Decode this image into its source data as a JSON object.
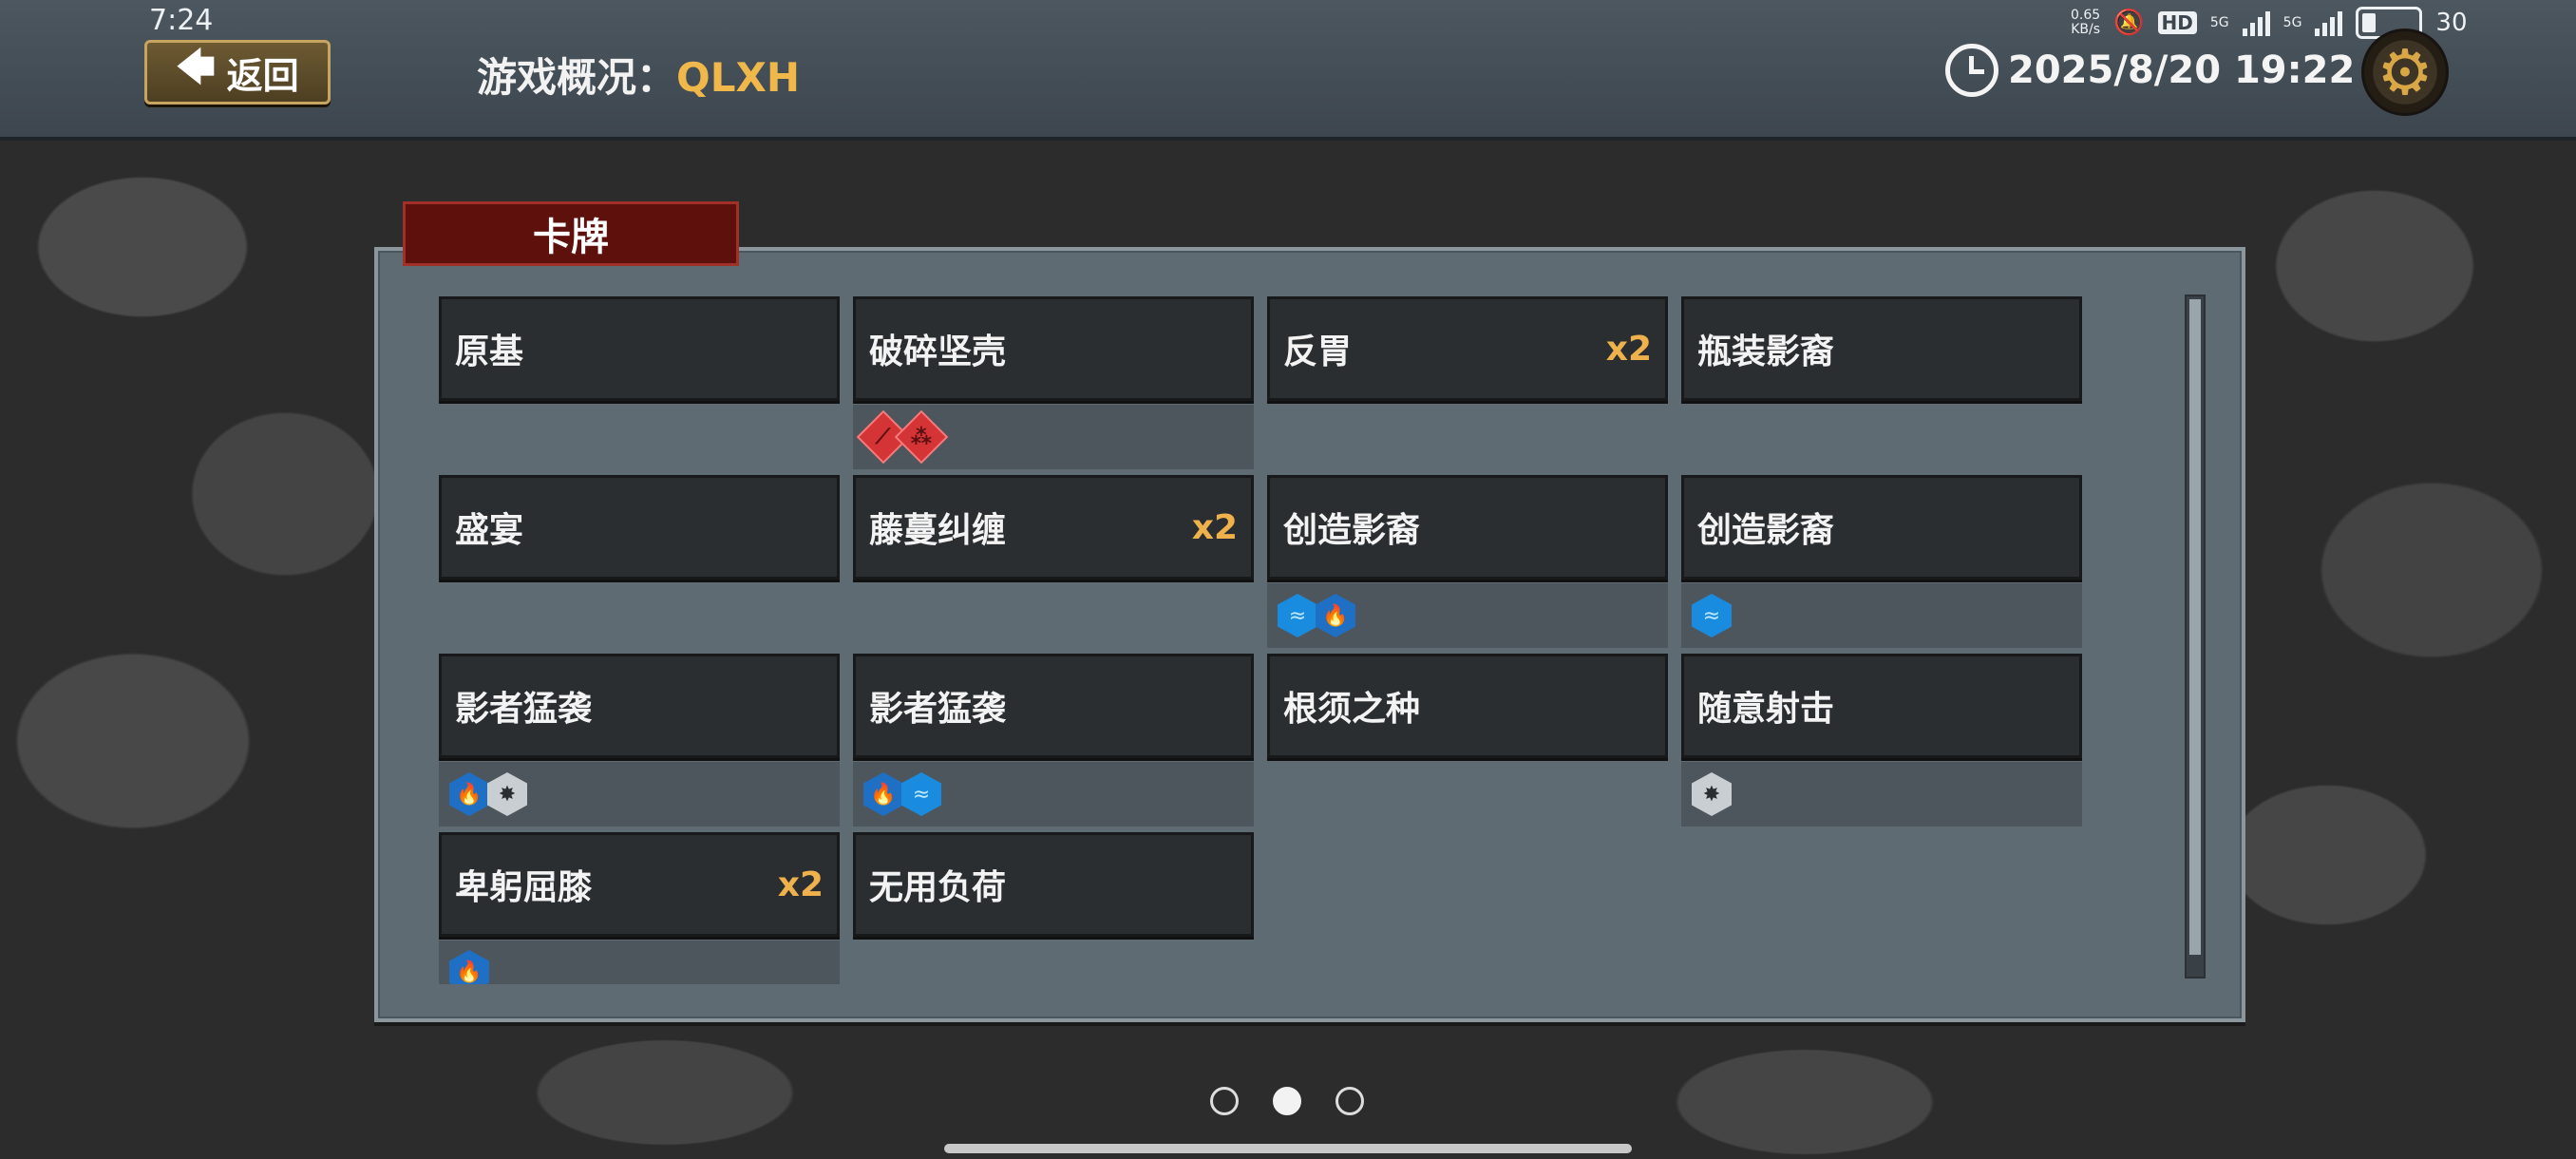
{
  "status_bar": {
    "time": "7:24",
    "net_speed_value": "0.65",
    "net_speed_unit": "KB/s",
    "hd_label": "HD",
    "signal_1_label": "5G",
    "signal_2_label": "5G",
    "battery_level": "30"
  },
  "header": {
    "back_label": "返回",
    "title_prefix": "游戏概况：",
    "game_name": "QLXH",
    "datetime": "2025/8/20 19:22"
  },
  "panel": {
    "tab_label": "卡牌"
  },
  "cards": [
    {
      "name": "原基",
      "count": "",
      "tags": []
    },
    {
      "name": "破碎坚壳",
      "count": "",
      "tags": [
        "sword",
        "bleed"
      ]
    },
    {
      "name": "反胃",
      "count": "x2",
      "tags": []
    },
    {
      "name": "瓶装影裔",
      "count": "",
      "tags": []
    },
    {
      "name": "盛宴",
      "count": "",
      "tags": []
    },
    {
      "name": "藤蔓纠缠",
      "count": "x2",
      "tags": []
    },
    {
      "name": "创造影裔",
      "count": "",
      "tags": [
        "water",
        "fire"
      ]
    },
    {
      "name": "创造影裔",
      "count": "",
      "tags": [
        "water"
      ]
    },
    {
      "name": "影者猛袭",
      "count": "",
      "tags": [
        "fire",
        "shadow"
      ]
    },
    {
      "name": "影者猛袭",
      "count": "",
      "tags": [
        "fire",
        "water"
      ]
    },
    {
      "name": "根须之种",
      "count": "",
      "tags": []
    },
    {
      "name": "随意射击",
      "count": "",
      "tags": [
        "shadow"
      ]
    },
    {
      "name": "卑躬屈膝",
      "count": "x2",
      "tags": [
        "fire"
      ]
    },
    {
      "name": "无用负荷",
      "count": "",
      "tags": []
    }
  ],
  "pager": {
    "pages": 3,
    "active_index": 1
  }
}
